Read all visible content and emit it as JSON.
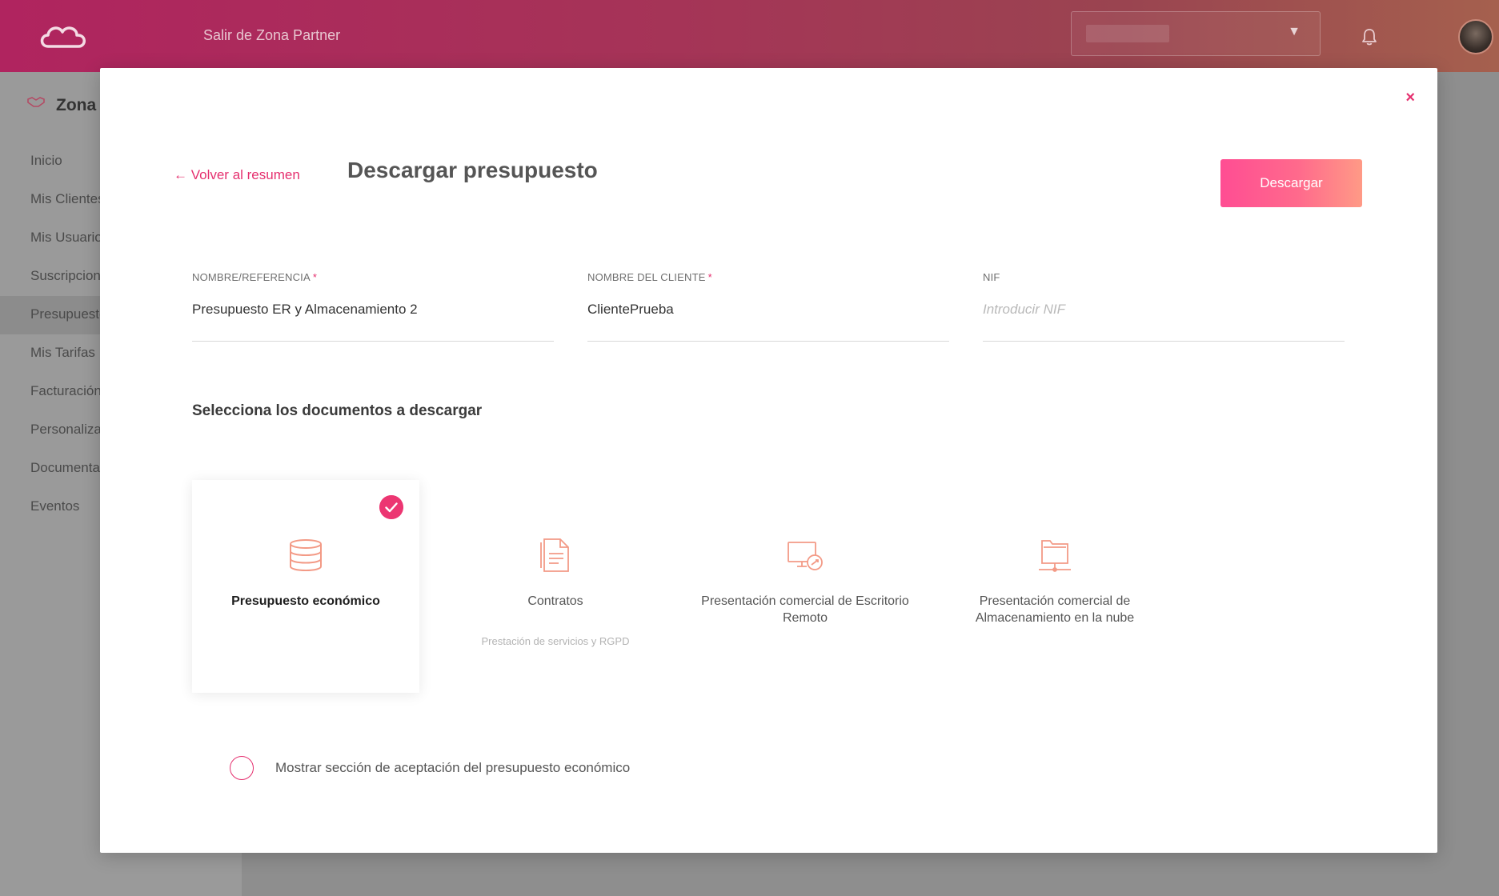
{
  "header": {
    "exit_link": "Salir de Zona Partner",
    "selector_caret": "▼"
  },
  "sidebar": {
    "title": "Zona P",
    "items": [
      "Inicio",
      "Mis Clientes",
      "Mis Usuario",
      "Suscripcione",
      "Presupuesto",
      "Mis Tarifas",
      "Facturación",
      "Personaliza",
      "Documenta",
      "Eventos"
    ]
  },
  "modal": {
    "close": "×",
    "back_link": "← Volver al resumen",
    "title": "Descargar presupuesto",
    "download_label": "Descargar",
    "fields": {
      "nombre": {
        "label": "NOMBRE/REFERENCIA",
        "required": "*",
        "value": "Presupuesto ER y Almacenamiento 2"
      },
      "cliente": {
        "label": "NOMBRE DEL CLIENTE",
        "required": "*",
        "value": "ClientePrueba"
      },
      "nif": {
        "label": "NIF",
        "value": "",
        "placeholder": "Introducir NIF"
      }
    },
    "section_title": "Selecciona los documentos a descargar",
    "documents": [
      {
        "name": "Presupuesto económico",
        "subtitle": "",
        "selected": true,
        "icon": "database-icon"
      },
      {
        "name": "Contratos",
        "subtitle": "Prestación de servicios y RGPD",
        "selected": false,
        "icon": "document-icon"
      },
      {
        "name": "Presentación comercial de Escritorio Remoto",
        "subtitle": "",
        "selected": false,
        "icon": "remote-desktop-icon"
      },
      {
        "name": "Presentación comercial de Almacenamiento en la nube",
        "subtitle": "",
        "selected": false,
        "icon": "cloud-folder-icon"
      }
    ],
    "option_label": "Mostrar sección de aceptación del presupuesto económico"
  },
  "colors": {
    "accent": "#e5306f",
    "icon_stroke": "#f39a86",
    "header_start": "#b0245f",
    "header_end": "#a5604e"
  }
}
